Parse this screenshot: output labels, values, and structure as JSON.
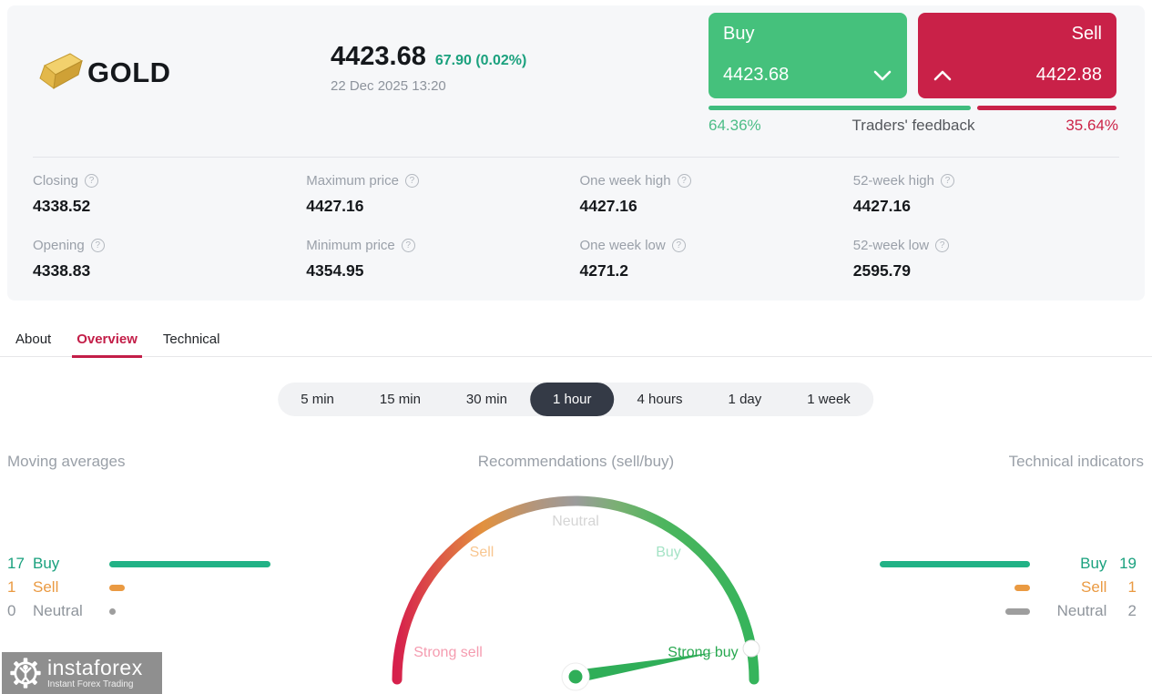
{
  "header": {
    "symbol": "GOLD",
    "price": "4423.68",
    "change": "67.90 (0.02%)",
    "datetime": "22 Dec 2025 13:20"
  },
  "trade": {
    "buy": {
      "label": "Buy",
      "price": "4423.68"
    },
    "sell": {
      "label": "Sell",
      "price": "4422.88"
    },
    "feedback": {
      "label": "Traders' feedback",
      "buy_percent": "64.36%",
      "sell_percent": "35.64%",
      "buy_value": 64.36,
      "sell_value": 35.64
    }
  },
  "stats": [
    {
      "label": "Closing",
      "value": "4338.52"
    },
    {
      "label": "Opening",
      "value": "4338.83"
    },
    {
      "label": "Maximum price",
      "value": "4427.16"
    },
    {
      "label": "Minimum price",
      "value": "4354.95"
    },
    {
      "label": "One week high",
      "value": "4427.16"
    },
    {
      "label": "One week low",
      "value": "4271.2"
    },
    {
      "label": "52-week high",
      "value": "4427.16"
    },
    {
      "label": "52-week low",
      "value": "2595.79"
    }
  ],
  "tabs": {
    "items": [
      {
        "label": "About",
        "active": false
      },
      {
        "label": "Overview",
        "active": true
      },
      {
        "label": "Technical",
        "active": false
      }
    ]
  },
  "timeframes": {
    "items": [
      {
        "label": "5 min",
        "active": false
      },
      {
        "label": "15 min",
        "active": false
      },
      {
        "label": "30 min",
        "active": false
      },
      {
        "label": "1 hour",
        "active": true
      },
      {
        "label": "4 hours",
        "active": false
      },
      {
        "label": "1 day",
        "active": false
      },
      {
        "label": "1 week",
        "active": false
      }
    ]
  },
  "panels": {
    "moving_averages": {
      "title": "Moving averages",
      "rows": [
        {
          "count": 17,
          "label": "Buy",
          "type": "buy"
        },
        {
          "count": 1,
          "label": "Sell",
          "type": "sell"
        },
        {
          "count": 0,
          "label": "Neutral",
          "type": "neutral"
        }
      ]
    },
    "recommendations": {
      "title": "Recommendations (sell/buy)",
      "scale_labels": [
        "Strong sell",
        "Sell",
        "Neutral",
        "Buy",
        "Strong buy"
      ],
      "needle_points_to": "Strong buy"
    },
    "technical_indicators": {
      "title": "Technical indicators",
      "rows": [
        {
          "count": 19,
          "label": "Buy",
          "type": "buy"
        },
        {
          "count": 1,
          "label": "Sell",
          "type": "sell"
        },
        {
          "count": 2,
          "label": "Neutral",
          "type": "neutral"
        }
      ]
    }
  },
  "watermark": {
    "brand": "instaforex",
    "tagline": "Instant Forex Trading"
  },
  "icons": {
    "help": "?"
  },
  "colors": {
    "buy_green": "#45c17c",
    "sell_red": "#c92148",
    "change_teal": "#1ba17e",
    "tab_active_red": "#c31e48",
    "timeframe_active_bg": "#343a46",
    "indicator_buy": "#1aa17e",
    "indicator_sell": "#ea9a42",
    "indicator_neutral": "#9e9e9e",
    "gauge_strong_sell": "#d6204c",
    "gauge_sell": "#e2913e",
    "gauge_neutral": "#9b9b9b",
    "gauge_buy": "#35b45b",
    "gauge_label_strong_sell": "#f59cb0",
    "gauge_label_sell": "#f8c690",
    "gauge_label_neutral": "#d5d5d5",
    "gauge_label_buy": "#a5e3c6",
    "gauge_label_strong_buy": "#28a850"
  }
}
